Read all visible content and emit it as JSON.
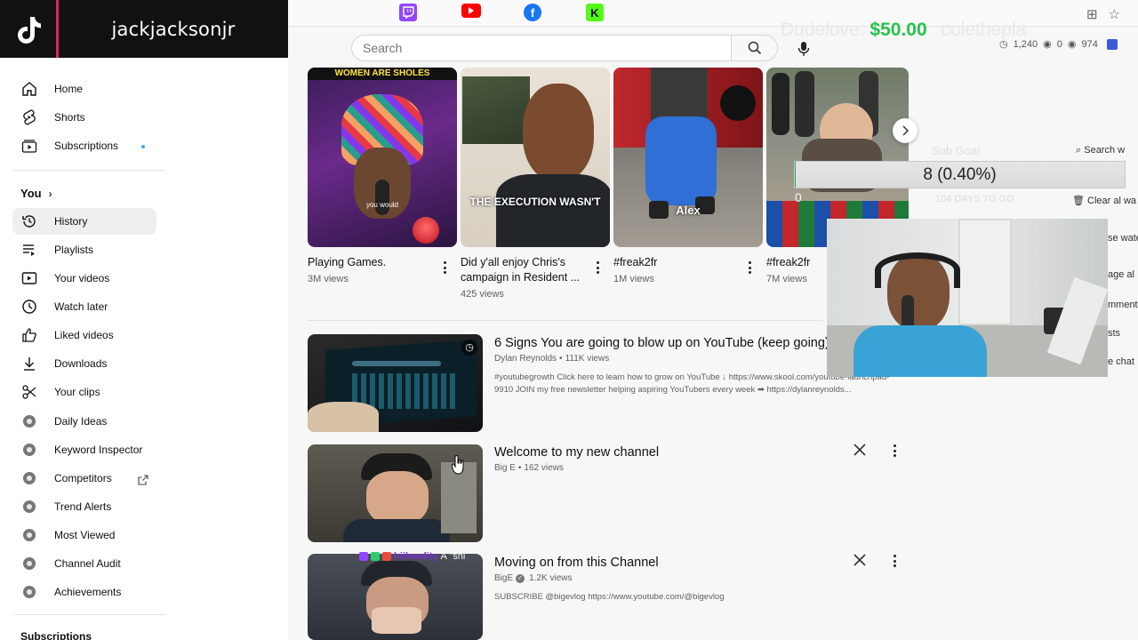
{
  "tiktok": {
    "username": "jackjacksonjr"
  },
  "social_bar": [
    {
      "platform": "twitch",
      "handle": "",
      "color": "#9146ff"
    },
    {
      "platform": "youtube",
      "handle": "",
      "color": "#ff0000"
    },
    {
      "platform": "facebook",
      "handle": "",
      "color": "#1877f2"
    },
    {
      "platform": "kick",
      "handle": "",
      "color": "#53fc18"
    }
  ],
  "donation": {
    "name": "Dudelove:",
    "amount": "$50.00",
    "tail": "colethepla"
  },
  "search": {
    "placeholder": "Search"
  },
  "stats": {
    "viewers": "1,240",
    "likes": "0",
    "views": "974"
  },
  "sidebar": {
    "main": [
      {
        "label": "Home",
        "icon": "home-icon"
      },
      {
        "label": "Shorts",
        "icon": "shorts-icon"
      },
      {
        "label": "Subscriptions",
        "icon": "subscriptions-icon"
      }
    ],
    "you_header": "You",
    "you_items": [
      {
        "label": "History",
        "icon": "history-icon",
        "active": true
      },
      {
        "label": "Playlists",
        "icon": "playlists-icon"
      },
      {
        "label": "Your videos",
        "icon": "your-videos-icon"
      },
      {
        "label": "Watch later",
        "icon": "watch-later-icon"
      },
      {
        "label": "Liked videos",
        "icon": "like-icon"
      },
      {
        "label": "Downloads",
        "icon": "download-icon"
      },
      {
        "label": "Your clips",
        "icon": "scissors-icon"
      }
    ],
    "extension_items": [
      {
        "label": "Daily Ideas"
      },
      {
        "label": "Keyword Inspector"
      },
      {
        "label": "Competitors"
      },
      {
        "label": "Trend Alerts"
      },
      {
        "label": "Most Viewed"
      },
      {
        "label": "Channel Audit"
      },
      {
        "label": "Achievements"
      }
    ],
    "subscriptions_header": "Subscriptions"
  },
  "shorts": [
    {
      "title": "Playing Games.",
      "title2": "",
      "views": "3M views",
      "overlay": "WOMEN ARE SHOLES",
      "caption": "you would"
    },
    {
      "title": "Did y'all enjoy Chris's",
      "title2": "campaign in Resident ...",
      "views": "425 views",
      "overlay": "",
      "caption": "THE EXECUTION WASN'T"
    },
    {
      "title": "#freak2fr",
      "title2": "",
      "views": "1M views",
      "overlay": "",
      "caption": "Alex"
    },
    {
      "title": "#freak2fr",
      "title2": "",
      "views": "7M views",
      "overlay": "",
      "caption": ""
    }
  ],
  "videos": [
    {
      "title": "6 Signs You are going to blow up on YouTube (keep going)",
      "channel": "Dylan Reynolds",
      "views": "111K views",
      "verified": false,
      "desc1": "#youtubegrowth Click here to learn how to grow on YouTube ↓ https://www.skool.com/youtube-launchpad-",
      "desc2": "9910 JOIN my free newsletter helping aspiring YouTubers every week ➡ https://dylanreynolds..."
    },
    {
      "title": "Welcome to my new channel",
      "channel": "Big E",
      "views": "162 views",
      "verified": false,
      "desc1": "",
      "desc2": ""
    },
    {
      "title": "Moving on from this Channel",
      "channel": "BigE",
      "views": "1.2K views",
      "verified": true,
      "desc1": "SUBSCRIBE @bigevlog https://www.youtube.com/@bigevlog",
      "desc2": ""
    }
  ],
  "subgoal": {
    "label": "Sub Goal",
    "value": "8 (0.40%)",
    "progress": 0.004,
    "days": "104 DAYS TO GO",
    "zero": "0"
  },
  "right_panel": {
    "search_label": "Search w",
    "clear_label": "Clear al wa",
    "items": [
      "se wate",
      "age al",
      "mment",
      "sts",
      "e chat"
    ]
  },
  "chat_overlay": {
    "user": "hiikwality",
    "message": "A \"shi"
  }
}
